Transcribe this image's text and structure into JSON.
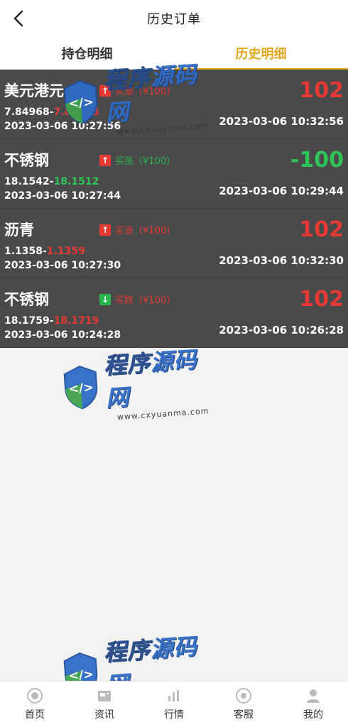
{
  "header": {
    "title": "历史订单"
  },
  "tabs": [
    {
      "label": "持仓明细",
      "active": false
    },
    {
      "label": "历史明细",
      "active": true
    }
  ],
  "orders": [
    {
      "name": "美元港元",
      "direction": "买涨",
      "direction_label": "买涨（¥100）",
      "dir_color": "red",
      "open_price": "7.84968",
      "close_price": "7.84978",
      "close_color": "red",
      "open_time": "2023-03-06 10:27:56",
      "close_time": "2023-03-06 10:32:56",
      "pnl": "102",
      "pnl_color": "red"
    },
    {
      "name": "不锈钢",
      "direction_label": "买涨（¥100）",
      "dir_color": "green",
      "open_price": "18.1542",
      "close_price": "18.1512",
      "close_color": "green",
      "open_time": "2023-03-06 10:27:44",
      "close_time": "2023-03-06 10:29:44",
      "pnl": "-100",
      "pnl_color": "green"
    },
    {
      "name": "沥青",
      "direction_label": "买涨（¥100）",
      "dir_color": "red",
      "open_price": "1.1358",
      "close_price": "1.1359",
      "close_color": "red",
      "open_time": "2023-03-06 10:27:30",
      "close_time": "2023-03-06 10:32:30",
      "pnl": "102",
      "pnl_color": "red"
    },
    {
      "name": "不锈钢",
      "direction_label": "买跌（¥100）",
      "dir_color": "red",
      "arrow_dir": "down",
      "arrow_color": "green",
      "open_price": "18.1759",
      "close_price": "18.1719",
      "close_color": "red",
      "open_time": "2023-03-06 10:24:28",
      "close_time": "2023-03-06 10:26:28",
      "pnl": "102",
      "pnl_color": "red"
    }
  ],
  "watermark": {
    "main_a": "程序",
    "main_b": "源码网",
    "sub": "www.cxyuanma.com"
  },
  "bottom_nav": [
    {
      "label": "首页",
      "icon": "home-icon"
    },
    {
      "label": "资讯",
      "icon": "news-icon"
    },
    {
      "label": "行情",
      "icon": "market-icon"
    },
    {
      "label": "客服",
      "icon": "support-icon"
    },
    {
      "label": "我的",
      "icon": "profile-icon"
    }
  ],
  "colors": {
    "accent": "#e3a81f",
    "up": "#e53935",
    "down": "#2ec458",
    "list_bg": "#4a4a4a"
  }
}
